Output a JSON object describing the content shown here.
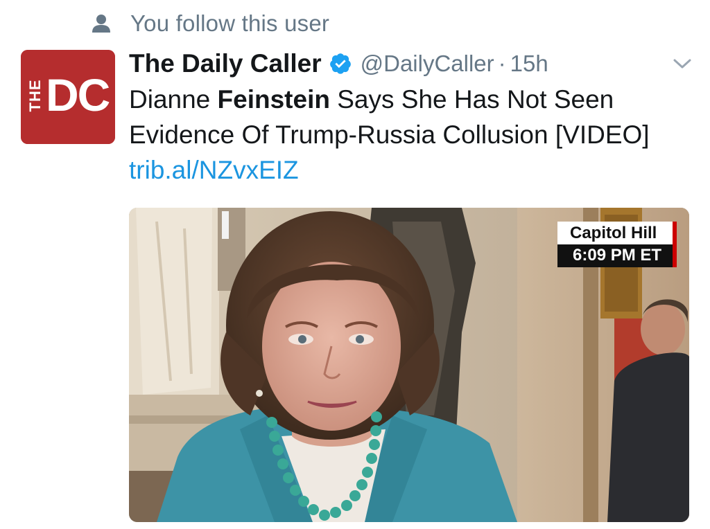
{
  "context": {
    "icon": "person-icon",
    "text": "You follow this user"
  },
  "tweet": {
    "avatar": {
      "text_the": "THE",
      "text_dc": "DC",
      "bg_color": "#b52d2e"
    },
    "display_name": "The Daily Caller",
    "verified": true,
    "handle": "@DailyCaller",
    "separator": "·",
    "time": "15h",
    "text_part1": "Dianne ",
    "text_bold": "Feinstein",
    "text_part2": " Says She Has Not Seen Evidence Of Trump-Russia Collusion [VIDEO] ",
    "link_text": "trib.al/NZvxEIZ",
    "link_color": "#1b95e0"
  },
  "media": {
    "location_label": "Capitol Hill",
    "time_label": "6:09 PM ET"
  }
}
